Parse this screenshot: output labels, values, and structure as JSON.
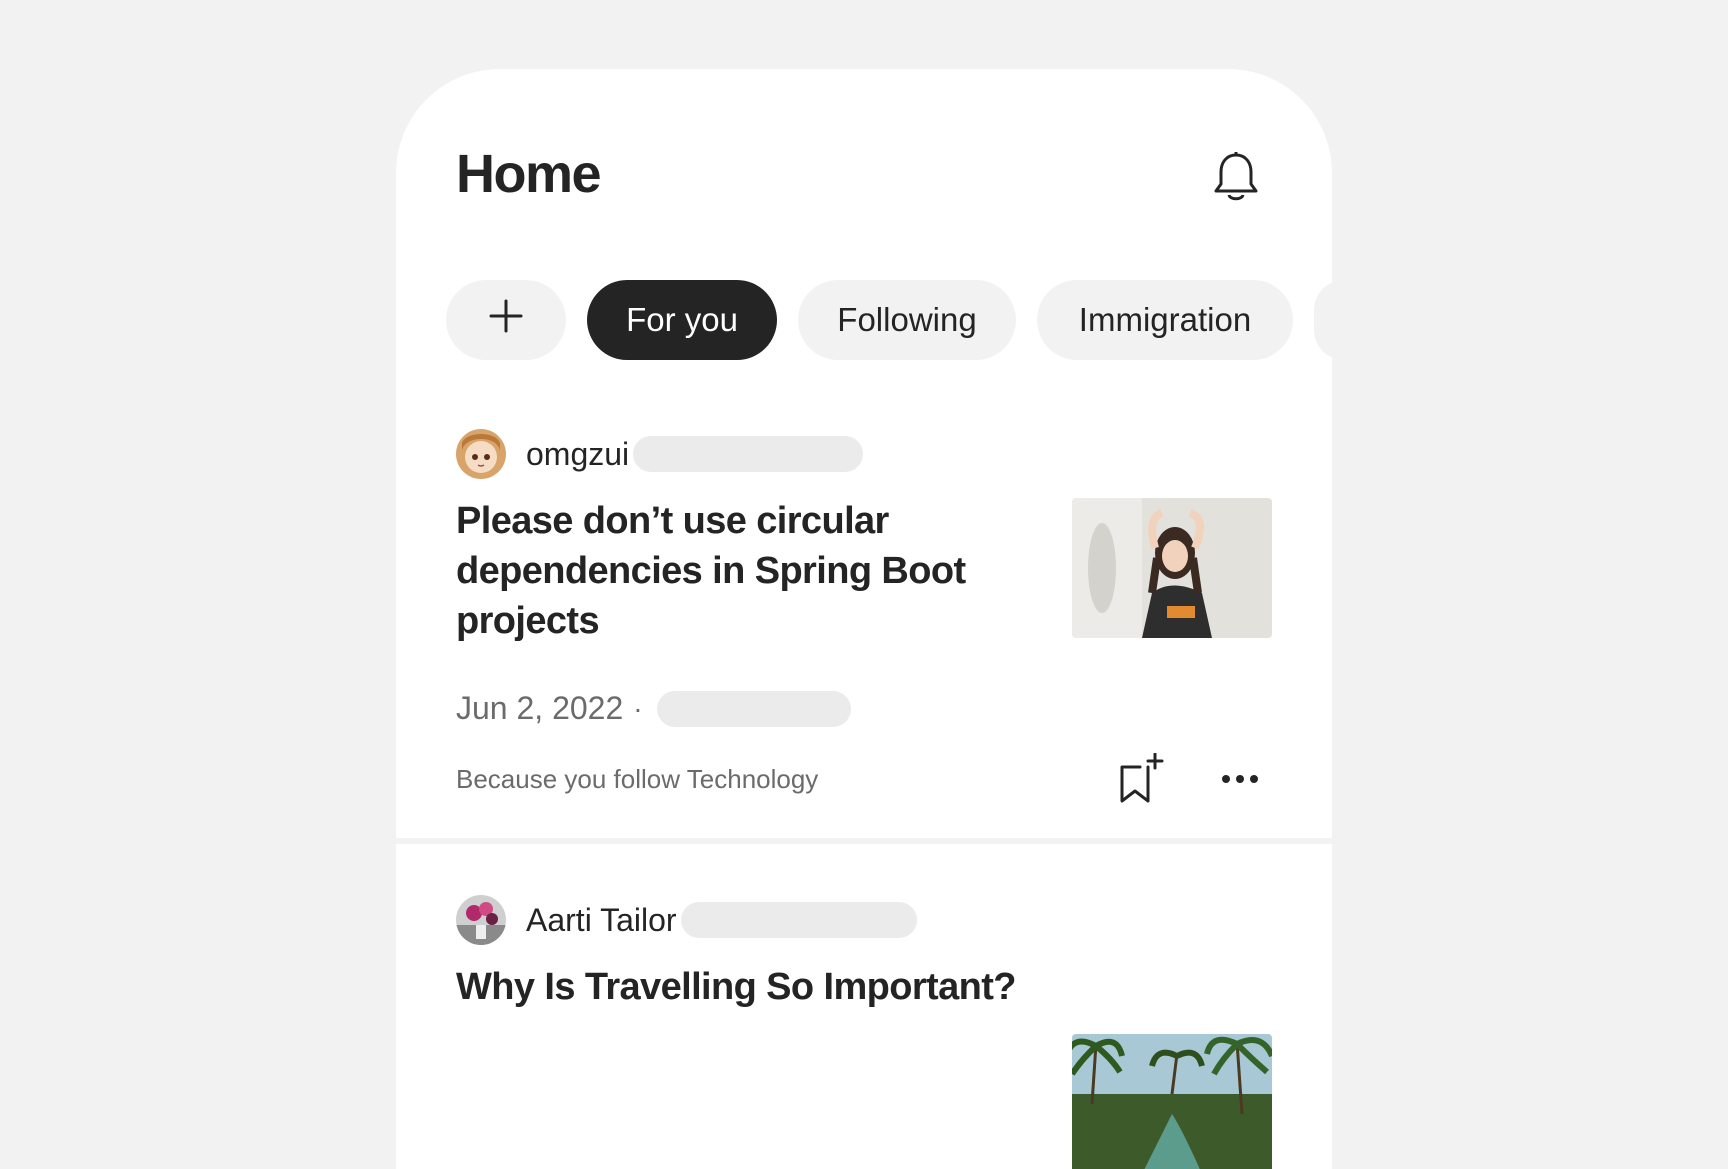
{
  "header": {
    "title": "Home"
  },
  "tabs": [
    {
      "label": "+",
      "icon": "plus-icon"
    },
    {
      "label": "For you",
      "active": true
    },
    {
      "label": "Following"
    },
    {
      "label": "Immigration"
    }
  ],
  "feed": [
    {
      "author": "omgzui",
      "title": "Please don’t use circular dependencies in Spring Boot projects",
      "date": "Jun 2, 2022",
      "separator": "·",
      "reason": "Because you follow Technology"
    },
    {
      "author": "Aarti Tailor",
      "title": "Why Is Travelling So Important?"
    }
  ],
  "colors": {
    "background": "#f2f2f2",
    "text": "#242424",
    "muted": "#6b6b6b",
    "active_chip": "#242424",
    "chip": "#f2f2f2"
  }
}
